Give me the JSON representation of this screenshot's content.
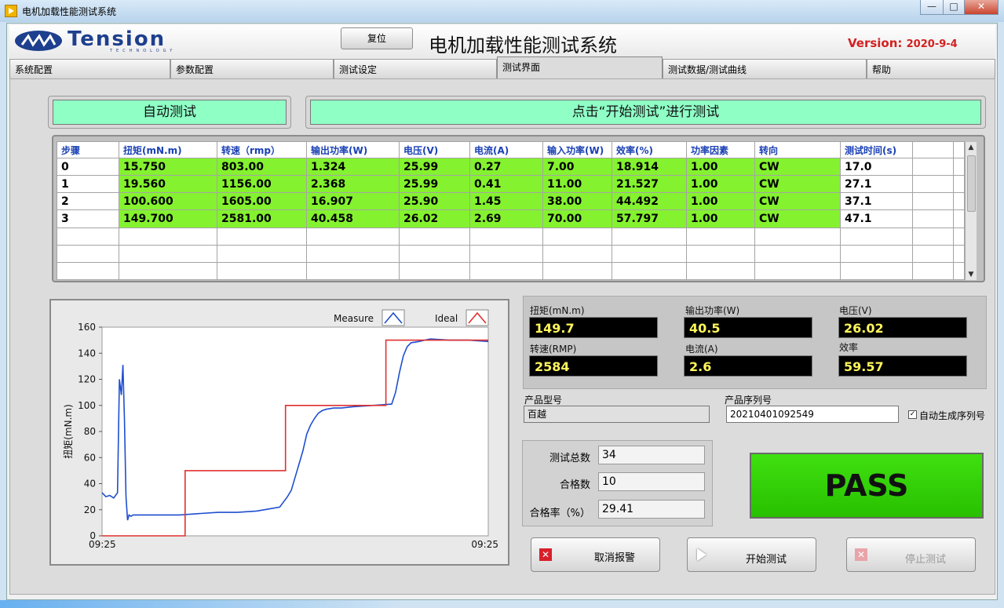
{
  "window": {
    "title": "电机加载性能测试系统",
    "minimize": "—",
    "maximize": "□",
    "close": "✕"
  },
  "header": {
    "logo_text": "Tension",
    "logo_sub": "TECHNOLOGY",
    "reset_button": "复位",
    "title": "电机加载性能测试系统",
    "version_label": "Version: ",
    "version_value": "2020-9-4"
  },
  "tabs": [
    "系统配置",
    "参数配置",
    "测试设定",
    "测试界面",
    "测试数据/测试曲线",
    "帮助"
  ],
  "active_tab": "测试界面",
  "banners": {
    "mode": "自动测试",
    "instruction": "点击“开始测试”进行测试"
  },
  "table": {
    "columns": [
      "步骤",
      "扭矩(mN.m)",
      "转速（rmp）",
      "输出功率(W)",
      "电压(V)",
      "电流(A)",
      "输入功率(W)",
      "效率(%)",
      "功率因素",
      "转向",
      "测试时间(s)",
      "",
      ""
    ],
    "rows": [
      [
        "0",
        "15.750",
        "803.00",
        "1.324",
        "25.99",
        "0.27",
        "7.00",
        "18.914",
        "1.00",
        "CW",
        "17.0",
        "",
        ""
      ],
      [
        "1",
        "19.560",
        "1156.00",
        "2.368",
        "25.99",
        "0.41",
        "11.00",
        "21.527",
        "1.00",
        "CW",
        "27.1",
        "",
        ""
      ],
      [
        "2",
        "100.600",
        "1605.00",
        "16.907",
        "25.90",
        "1.45",
        "38.00",
        "44.492",
        "1.00",
        "CW",
        "37.1",
        "",
        ""
      ],
      [
        "3",
        "149.700",
        "2581.00",
        "40.458",
        "26.02",
        "2.69",
        "70.00",
        "57.797",
        "1.00",
        "CW",
        "47.1",
        "",
        ""
      ]
    ],
    "empty_rows": 3
  },
  "chart_data": {
    "type": "line",
    "title": "",
    "xlabel": "",
    "ylabel": "扭矩(mN.m)",
    "ylim": [
      0,
      160
    ],
    "yticks": [
      0,
      20,
      40,
      60,
      80,
      100,
      120,
      140,
      160
    ],
    "xlim": [
      0,
      100
    ],
    "xtick_labels": [
      "09:25",
      "09:25"
    ],
    "grid": false,
    "legend_position": "top-right",
    "series": [
      {
        "name": "Measure",
        "color": "#1f4fd0",
        "x": [
          0,
          1,
          2,
          3,
          4,
          4.5,
          5,
          5.4,
          5.8,
          6.2,
          6.6,
          7,
          7.5,
          8,
          9,
          12,
          15,
          20,
          25,
          30,
          35,
          40,
          42,
          44,
          46,
          47,
          48,
          49,
          50,
          51,
          52,
          53,
          54,
          55,
          56,
          57,
          58,
          60,
          62,
          65,
          70,
          75,
          76,
          77,
          78,
          79,
          80,
          82,
          85,
          90,
          95,
          100
        ],
        "y": [
          33,
          30,
          31,
          29,
          33,
          120,
          108,
          131,
          90,
          30,
          12,
          16,
          15,
          16,
          16,
          16,
          16,
          16,
          17,
          18,
          18,
          19,
          20,
          21,
          22,
          26,
          30,
          35,
          45,
          55,
          65,
          78,
          85,
          90,
          94,
          96,
          97,
          98,
          98,
          99,
          100,
          101,
          110,
          125,
          138,
          145,
          148,
          149,
          151,
          150,
          150,
          149
        ]
      },
      {
        "name": "Ideal",
        "color": "#e03030",
        "x": [
          0,
          21.5,
          21.5,
          47.5,
          47.5,
          73.5,
          73.5,
          100
        ],
        "y": [
          0,
          0,
          50,
          50,
          100,
          100,
          150,
          150
        ]
      }
    ]
  },
  "readouts": {
    "torque": {
      "label": "扭矩(mN.m)",
      "value": "149.7"
    },
    "output_power": {
      "label": "输出功率(W)",
      "value": "40.5"
    },
    "voltage": {
      "label": "电压(V)",
      "value": "26.02"
    },
    "speed": {
      "label": "转速(RMP)",
      "value": "2584"
    },
    "current": {
      "label": "电流(A)",
      "value": "2.6"
    },
    "efficiency": {
      "label": "效率",
      "value": "59.57"
    }
  },
  "product": {
    "model_label": "产品型号",
    "model_value": "百越",
    "serial_label": "产品序列号",
    "serial_value": "20210401092549",
    "auto_serial_label": "自动生成序列号",
    "auto_serial_checked": "✓"
  },
  "stats": {
    "total_label": "测试总数",
    "total_value": "34",
    "pass_label": "合格数",
    "pass_value": "10",
    "rate_label": "合格率（%）",
    "rate_value": "29.41"
  },
  "result": "PASS",
  "buttons": {
    "cancel_alarm": "取消报警",
    "start_test": "开始测试",
    "stop_test": "停止测试"
  },
  "colors": {
    "banner_green": "#8fffc6",
    "cell_green": "#84f22f",
    "pass_green": "#3fe010",
    "readout_text": "#fff65a",
    "version_red": "#d42020"
  }
}
